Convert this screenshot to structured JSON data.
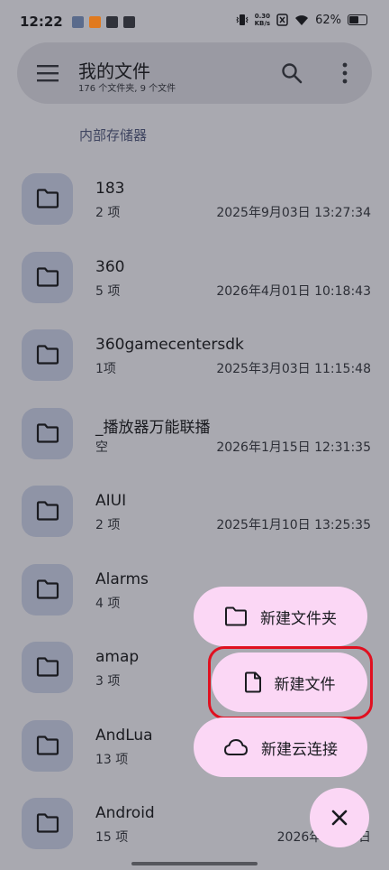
{
  "status_bar": {
    "time": "12:22",
    "net_speed_value": "0.30",
    "net_speed_unit": "KB/s",
    "battery_text": "62%",
    "battery_level": 0.62
  },
  "header": {
    "title": "我的文件",
    "subtitle": "176 个文件夹, 9 个文件",
    "menu_icon": "hamburger-menu-icon",
    "search_icon": "search-icon",
    "more_icon": "more-vert-icon"
  },
  "section_label": "内部存储器",
  "files": [
    {
      "name": "183",
      "count": "2 项",
      "date": "2025年9月03日 13:27:34"
    },
    {
      "name": "360",
      "count": "5 项",
      "date": "2026年4月01日 10:18:43"
    },
    {
      "name": "360gamecentersdk",
      "count": "1项",
      "date": "2025年3月03日 11:15:48"
    },
    {
      "name": "_播放器万能联播",
      "count": "空",
      "date": "2026年1月15日 12:31:35"
    },
    {
      "name": "AIUI",
      "count": "2 项",
      "date": "2025年1月10日 13:25:35"
    },
    {
      "name": "Alarms",
      "count": "4 项",
      "date": ""
    },
    {
      "name": "amap",
      "count": "3 项",
      "date": ""
    },
    {
      "name": "AndLua",
      "count": "13 项",
      "date": ""
    },
    {
      "name": "Android",
      "count": "15 项",
      "date": "2026年3月31日"
    }
  ],
  "fab_menu": {
    "new_folder_label": "新建文件夹",
    "new_file_label": "新建文件",
    "new_cloud_label": "新建云连接",
    "close_icon": "close-icon",
    "accent_color": "#fbd7f5",
    "highlight_color": "#e01020"
  }
}
